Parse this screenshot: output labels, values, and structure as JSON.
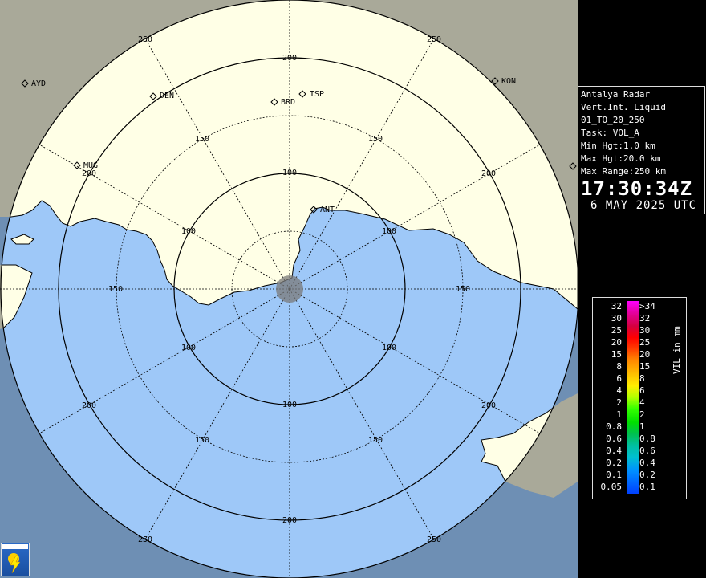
{
  "radar": {
    "stations": [
      {
        "name": "AYD"
      },
      {
        "name": "DEN"
      },
      {
        "name": "BRD"
      },
      {
        "name": "ISP"
      },
      {
        "name": "KON"
      },
      {
        "name": "MUG"
      },
      {
        "name": "ANT"
      }
    ],
    "range_labels": [
      "100",
      "150",
      "200",
      "250"
    ]
  },
  "info": {
    "title": "Antalya Radar",
    "product": "Vert.Int. Liquid",
    "code": "01_TO_20_250",
    "task": "Task: VOL_A",
    "min_hgt": "Min Hgt:1.0 km",
    "max_hgt": "Max Hgt:20.0 km",
    "max_range": "Max Range:250 km",
    "time": "17:30:34Z",
    "date": "6 MAY 2025 UTC"
  },
  "legend": {
    "unit": "VIL in mm",
    "left": [
      "32",
      "30",
      "25",
      "20",
      "15",
      "8",
      "6",
      "4",
      "2",
      "1",
      "0.8",
      "0.6",
      "0.4",
      "0.2",
      "0.1",
      "0.05"
    ],
    "right": [
      ">34",
      "32",
      "30",
      "25",
      "20",
      "15",
      "8",
      "6",
      "4",
      "2",
      "1",
      "0.8",
      "0.6",
      "0.4",
      "0.2",
      "0.1"
    ],
    "colors": {
      "sea": "#9ec8f8",
      "land_in_range": "#ffffe6",
      "land_out_range": "#a9a999",
      "sea_out_range": "#6e8fb4"
    }
  }
}
